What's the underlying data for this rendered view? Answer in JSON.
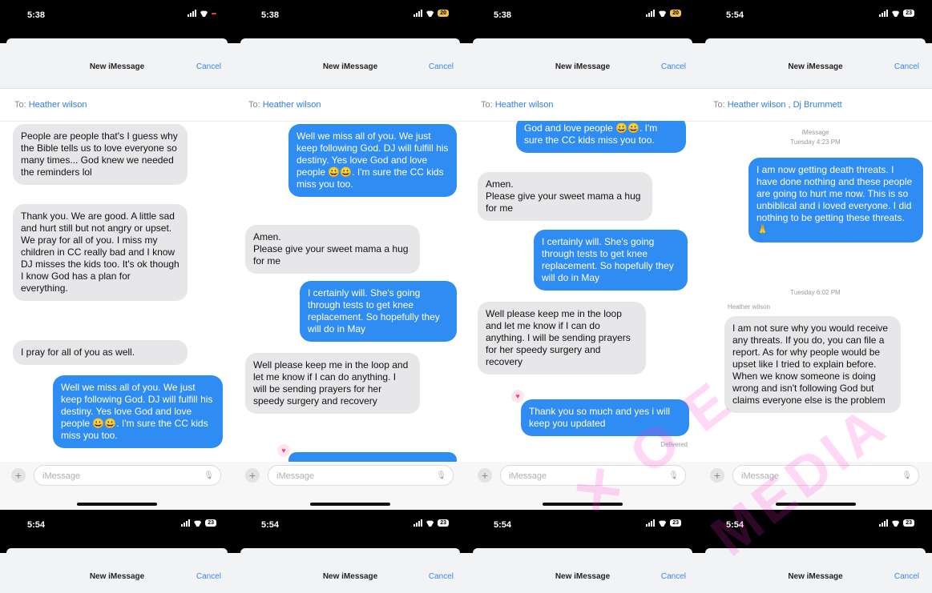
{
  "status": {
    "p1_time": "5:38",
    "p2_time": "5:38",
    "p3_time": "5:38",
    "p4_time": "5:54",
    "b1": "5:54",
    "b2": "5:54",
    "b3": "5:54",
    "b4": "5:54",
    "batt_a": "",
    "batt_b": "20",
    "batt_c": "23"
  },
  "header": {
    "title": "New iMessage",
    "cancel": "Cancel"
  },
  "to": {
    "label": "To:",
    "p1": "Heather wilson",
    "p2": "Heather wilson",
    "p3": "Heather wilson",
    "p4": "Heather wilson , Dj Brummett"
  },
  "input": {
    "placeholder": "iMessage"
  },
  "p1": {
    "m1": "People are people that's I guess why the Bible tells us to love everyone so many times... God knew we needed the reminders lol",
    "m2": "Thank you. We are good. A little sad and hurt still but not angry or upset. We pray for all of you. I miss my children in CC really bad and I know DJ misses the kids too. It's ok though I know God has a plan for everything.",
    "m3": "I pray for all of you as well.",
    "m4": "Well we miss all of you.  We just keep following God.  DJ will fulfill his destiny.  Yes love God and love people 😀😀. I'm sure the CC kids miss you too."
  },
  "p2": {
    "m1": "Well we miss all of you.  We just keep following God.  DJ will fulfill his destiny.  Yes love God and love people 😀😀. I'm sure the CC kids miss you too.",
    "m2": "Amen.\nPlease give your sweet mama a hug for me",
    "m3": "I certainly will.  She's going through tests to get knee replacement. So hopefully they will do in May",
    "m4": "Well please keep me in the loop and let me know if I can do anything. I will be sending prayers for her speedy surgery and recovery"
  },
  "p3": {
    "m1": "God and love people 😀😀. I'm sure the CC kids miss you too.",
    "m2": "Amen.\nPlease give your sweet mama a hug for me",
    "m3": "I certainly will.  She's going through tests to get knee replacement. So hopefully they will do in May",
    "m4": "Well please keep me in the loop and let me know if I can do anything. I will be sending prayers for her speedy surgery and recovery",
    "m5": "Thank you so much and yes i will keep you updated",
    "delivered": "Delivered"
  },
  "p4": {
    "service": "iMessage",
    "ts1": "Tuesday 4:23 PM",
    "m1": "I am now getting death threats. I have done nothing and these people are going to hurt me now.  This is so unbiblical and i loved everyone. I did nothing to be getting these threats. 🙏",
    "ts2": "Tuesday 6:02 PM",
    "sender": "Heather wilson",
    "m2": "I am not sure why you would receive any threats. If you do, you can file a report. As for why people would be upset like I tried to explain before. When we know someone is doing wrong and isn't following God but claims everyone else is the problem"
  },
  "icons": {
    "plus": "+",
    "mic": "🎙",
    "heart": "♥"
  },
  "colors": {
    "accent": "#2f8cf3",
    "incoming": "#e7e7ea",
    "watermark": "#ff2fd0"
  }
}
